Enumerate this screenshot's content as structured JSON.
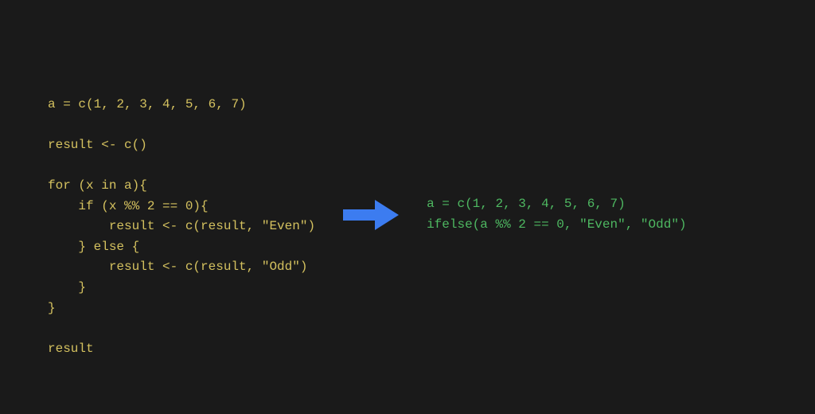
{
  "left_code": "a = c(1, 2, 3, 4, 5, 6, 7)\n\nresult <- c()\n\nfor (x in a){\n    if (x %% 2 == 0){\n        result <- c(result, \"Even\")\n    } else {\n        result <- c(result, \"Odd\")\n    }\n}\n\nresult",
  "right_code": "a = c(1, 2, 3, 4, 5, 6, 7)\nifelse(a %% 2 == 0, \"Even\", \"Odd\")",
  "colors": {
    "background": "#1a1a1a",
    "left_text": "#d4c15f",
    "right_text": "#4eb861",
    "arrow": "#3c7cf0"
  }
}
